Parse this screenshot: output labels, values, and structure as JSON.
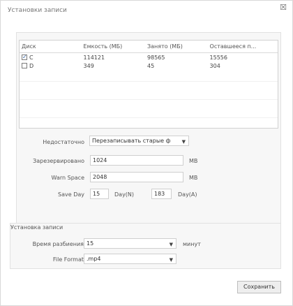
{
  "window": {
    "title": "Установки записи",
    "close_icon": "close-icon"
  },
  "disk_table": {
    "headers": [
      "Диск",
      "Емкость (МБ)",
      "Занято (МБ)",
      "Оставшееся п..."
    ],
    "rows": [
      {
        "checked": true,
        "disk": "C",
        "capacity": "114121",
        "used": "98565",
        "remaining": "15556"
      },
      {
        "checked": false,
        "disk": "D",
        "capacity": "349",
        "used": "45",
        "remaining": "304"
      }
    ]
  },
  "storage": {
    "insufficient_label": "Недостаточно",
    "insufficient_value": "Перезаписывать старые ф",
    "reserved_label": "Зарезервировано",
    "reserved_value": "1024",
    "reserved_unit": "MB",
    "warn_label": "Warn Space",
    "warn_value": "2048",
    "warn_unit": "MB",
    "save_day_label": "Save Day",
    "save_day_value": "15",
    "save_day_unit": "Day(N)",
    "day_a_value": "183",
    "day_a_unit": "Day(A)"
  },
  "record_settings": {
    "group_title": "Установка записи",
    "split_label": "Время разбиения",
    "split_value": "15",
    "split_unit": "минут",
    "format_label": "File Format",
    "format_value": ".mp4"
  },
  "actions": {
    "save_label": "Сохранить"
  }
}
